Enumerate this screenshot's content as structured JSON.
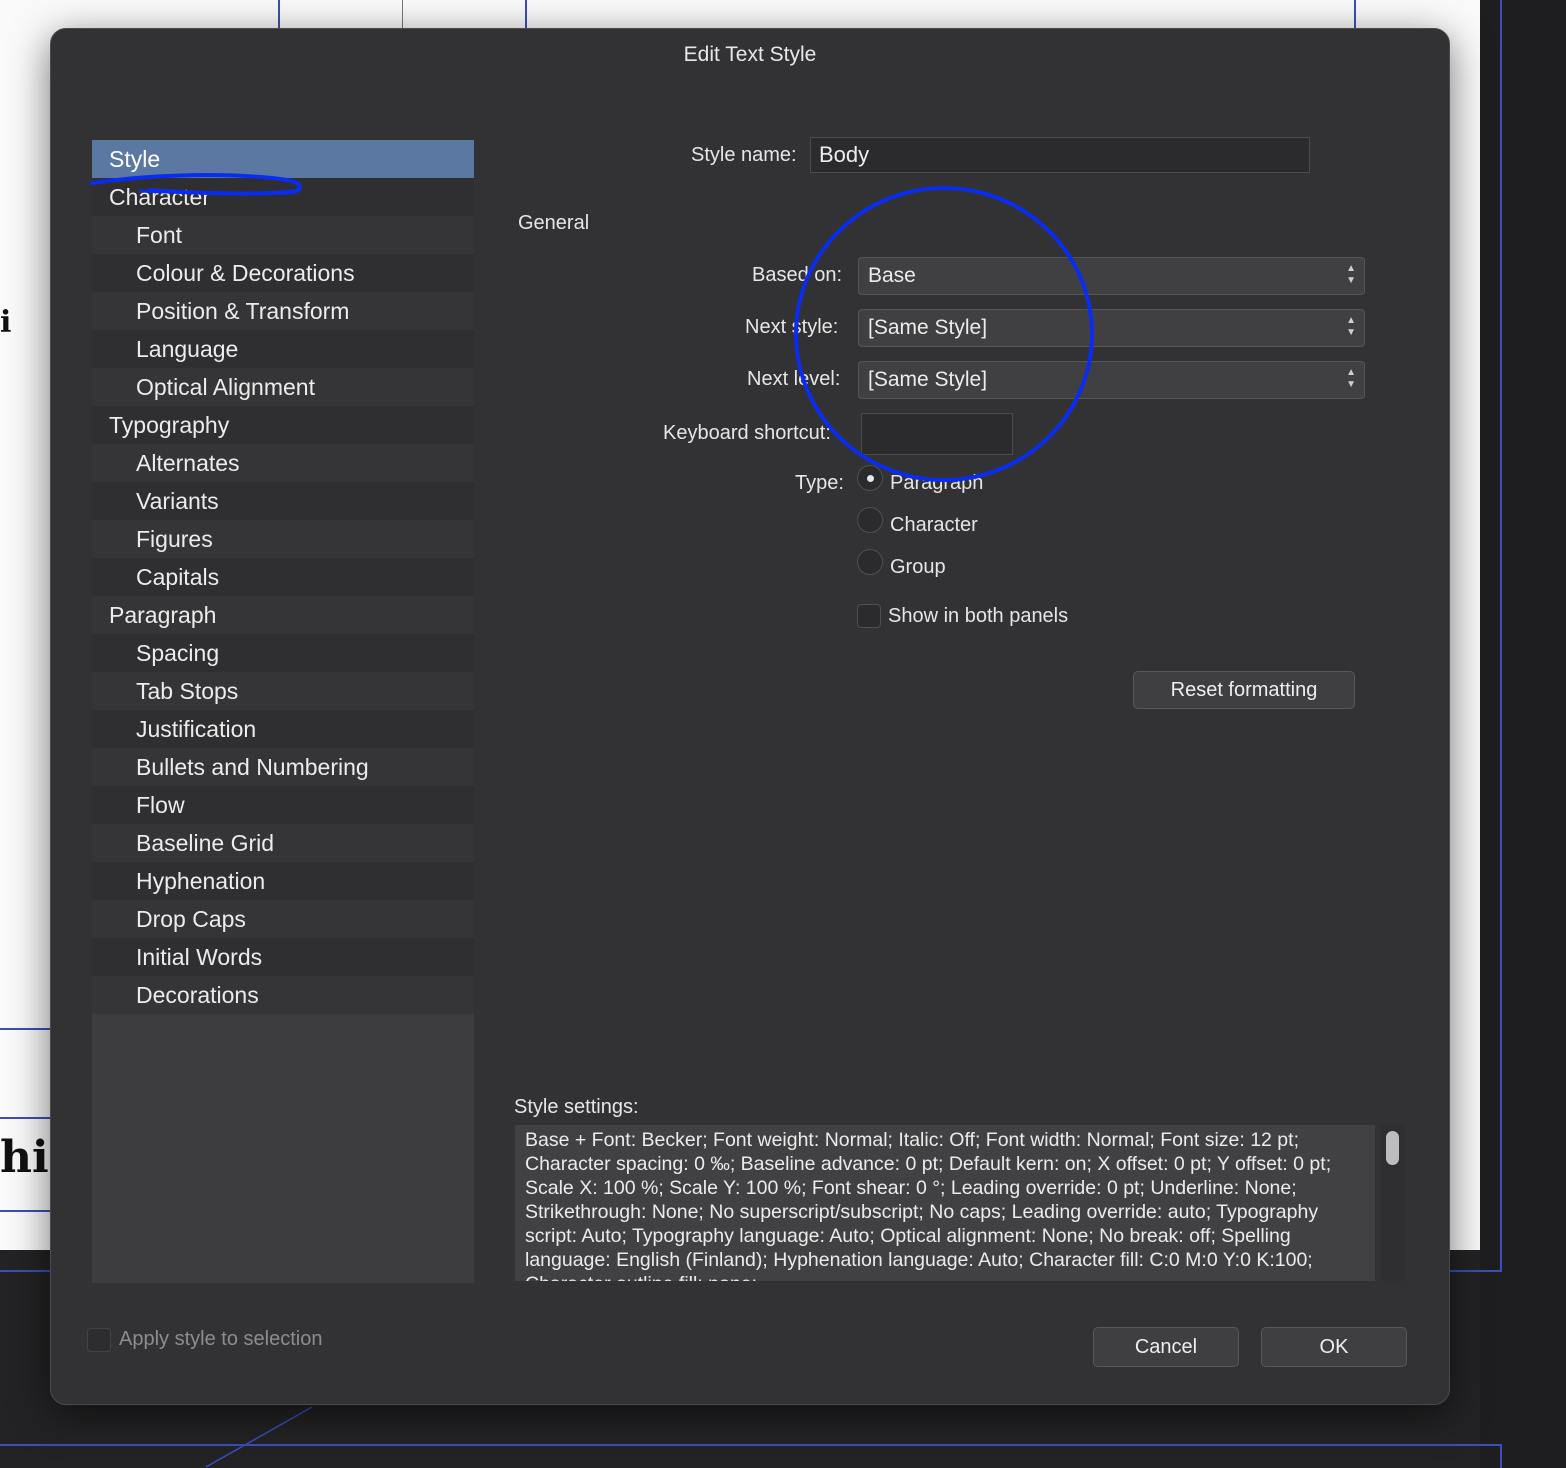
{
  "dialog": {
    "title": "Edit Text Style"
  },
  "sidebar": {
    "items": [
      {
        "label": "Style",
        "level": 0,
        "selected": true
      },
      {
        "label": "Character",
        "level": 0
      },
      {
        "label": "Font",
        "level": 1
      },
      {
        "label": "Colour & Decorations",
        "level": 1
      },
      {
        "label": "Position & Transform",
        "level": 1
      },
      {
        "label": "Language",
        "level": 1
      },
      {
        "label": "Optical Alignment",
        "level": 1
      },
      {
        "label": "Typography",
        "level": 0
      },
      {
        "label": "Alternates",
        "level": 1
      },
      {
        "label": "Variants",
        "level": 1
      },
      {
        "label": "Figures",
        "level": 1
      },
      {
        "label": "Capitals",
        "level": 1
      },
      {
        "label": "Paragraph",
        "level": 0
      },
      {
        "label": "Spacing",
        "level": 1
      },
      {
        "label": "Tab Stops",
        "level": 1
      },
      {
        "label": "Justification",
        "level": 1
      },
      {
        "label": "Bullets and Numbering",
        "level": 1
      },
      {
        "label": "Flow",
        "level": 1
      },
      {
        "label": "Baseline Grid",
        "level": 1
      },
      {
        "label": "Hyphenation",
        "level": 1
      },
      {
        "label": "Drop Caps",
        "level": 1
      },
      {
        "label": "Initial Words",
        "level": 1
      },
      {
        "label": "Decorations",
        "level": 1
      }
    ]
  },
  "form": {
    "style_name_label": "Style name:",
    "style_name_value": "Body",
    "section_general": "General",
    "based_on_label": "Based on:",
    "based_on_value": "Base",
    "next_style_label": "Next style:",
    "next_style_value": "[Same Style]",
    "next_level_label": "Next level:",
    "next_level_value": "[Same Style]",
    "keyboard_shortcut_label": "Keyboard shortcut:",
    "keyboard_shortcut_value": "",
    "type_label": "Type:",
    "type_options": [
      "Paragraph",
      "Character",
      "Group"
    ],
    "type_selected": "Paragraph",
    "show_both_panels_label": "Show in both panels",
    "show_both_panels_checked": false,
    "reset_formatting_label": "Reset formatting",
    "style_settings_label": "Style settings:",
    "style_settings_text": "Base + Font: Becker; Font weight: Normal; Italic: Off; Font width: Normal; Font size: 12 pt; Character spacing: 0 ‰; Baseline advance: 0 pt; Default kern: on; X offset: 0 pt; Y offset: 0 pt; Scale X: 100 %; Scale Y: 100 %; Font shear: 0 °; Leading override: 0 pt; Underline: None; Strikethrough: None; No superscript/subscript; No caps; Leading override: auto; Typography script: Auto; Typography language: Auto; Optical alignment: None; No break: off; Spelling language: English (Finland); Hyphenation language: Auto; Character fill: C:0 M:0 Y:0 K:100; Character outline fill: none;"
  },
  "footer": {
    "apply_to_selection_label": "Apply style to selection",
    "apply_to_selection_checked": false,
    "cancel_label": "Cancel",
    "ok_label": "OK"
  },
  "background": {
    "fragment_1": "i",
    "fragment_2": "hin"
  },
  "colors": {
    "selection": "#5b78a3",
    "annotation": "#0a2cf0"
  }
}
